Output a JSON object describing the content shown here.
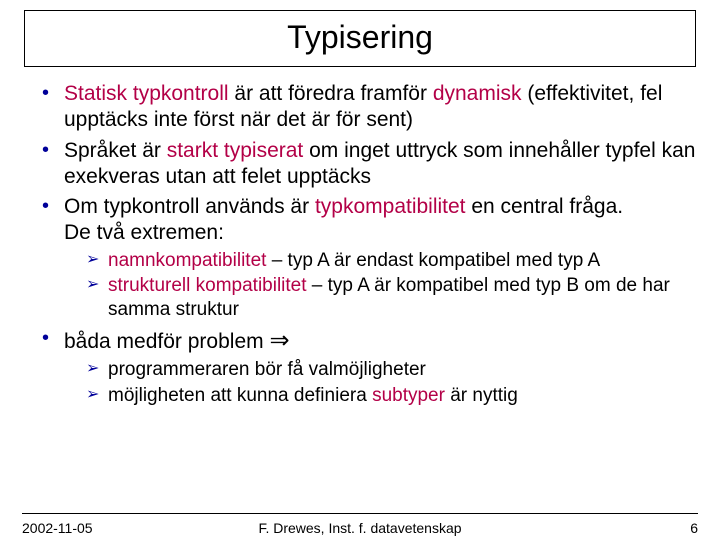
{
  "title": "Typisering",
  "bullets": {
    "b1_pre": "Statisk typkontroll",
    "b1_mid": " är att föredra framför ",
    "b1_dyn": "dynamisk",
    "b1_post": " (effektivitet, fel upptäcks inte först när det är för sent)",
    "b2_pre": "Språket är ",
    "b2_em": "starkt typiserat",
    "b2_post": " om inget uttryck som innehåller typfel kan exekveras utan att felet upptäcks",
    "b3_pre": "Om typkontroll används är ",
    "b3_em": "typkompatibilitet",
    "b3_post": " en central fråga.",
    "b3_extra": "De två extremen:",
    "s1_em": "namnkompatibilitet",
    "s1_post": " – typ A är endast kompatibel med typ A",
    "s2_em": "strukturell kompatibilitet",
    "s2_post": " – typ A är kompatibel med typ B om de har samma struktur",
    "b4_text": "båda medför problem ",
    "b4_sym": "⇒",
    "s3": "programmeraren bör få valmöjligheter",
    "s4_pre": "möjligheten att kunna definiera ",
    "s4_em": "subtyper",
    "s4_post": " är nyttig"
  },
  "footer": {
    "date": "2002-11-05",
    "author": "F. Drewes, Inst. f. datavetenskap",
    "page": "6"
  }
}
